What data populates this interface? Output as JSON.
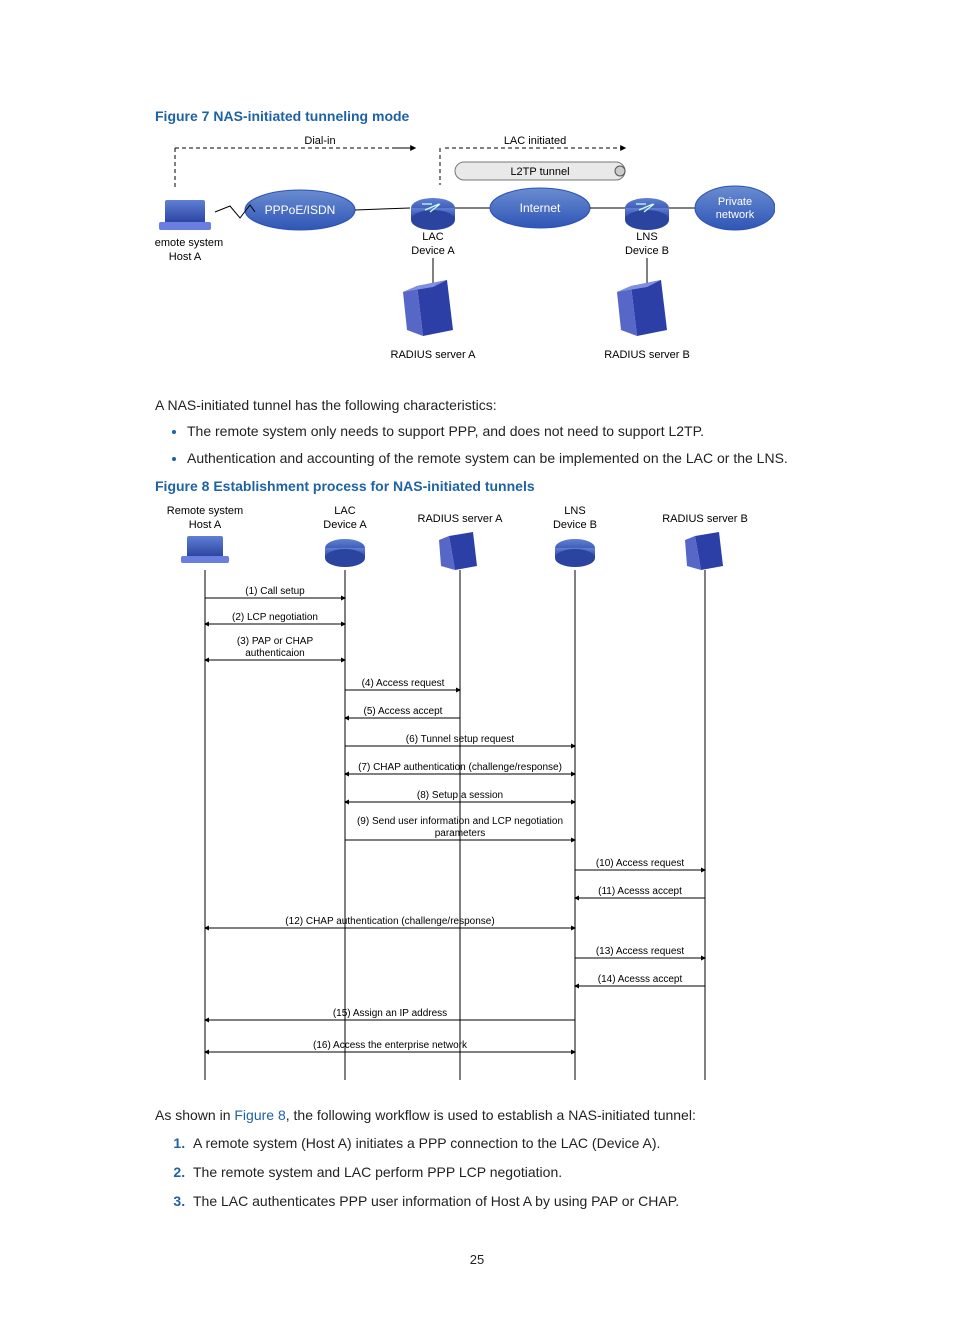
{
  "figure7": {
    "caption": "Figure 7 NAS-initiated tunneling mode",
    "dial_in": "Dial-in",
    "lac_initiated": "LAC initiated",
    "l2tp_tunnel": "L2TP tunnel",
    "pppoe": "PPPoE/ISDN",
    "internet": "Internet",
    "private_net": "Private network",
    "lac": "LAC",
    "dev_a": "Device A",
    "lns": "LNS",
    "dev_b": "Device B",
    "remote_sys": "Remote system",
    "host_a": "Host A",
    "radius_a": "RADIUS server A",
    "radius_b": "RADIUS server B"
  },
  "intro1": "A NAS-initiated tunnel has the following characteristics:",
  "bullets": [
    "The remote system only needs to support PPP, and does not need to support L2TP.",
    "Authentication and accounting of the remote system can be implemented on the LAC or the LNS."
  ],
  "figure8": {
    "caption": "Figure 8 Establishment process for NAS-initiated tunnels",
    "nodes": {
      "remote_sys": "Remote system",
      "host_a": "Host A",
      "lac": "LAC",
      "dev_a": "Device A",
      "radius_a": "RADIUS server A",
      "lns": "LNS",
      "dev_b": "Device B",
      "radius_b": "RADIUS server B"
    },
    "steps": {
      "s1": "(1) Call setup",
      "s2": "(2) LCP negotiation",
      "s3": "(3) PAP or CHAP",
      "s3b": "authenticaion",
      "s4": "(4) Access request",
      "s5": "(5) Access accept",
      "s6": "(6) Tunnel setup request",
      "s7": "(7) CHAP authentication (challenge/response)",
      "s8": "(8) Setup a session",
      "s9a": "(9) Send user information and LCP negotiation",
      "s9b": "parameters",
      "s10": "(10) Access request",
      "s11": "(11) Acesss accept",
      "s12": "(12) CHAP authentication (challenge/response)",
      "s13": "(13) Access request",
      "s14": "(14) Acesss accept",
      "s15": "(15) Assign an IP address",
      "s16": "(16) Access the enterprise network"
    }
  },
  "intro2_pre": "As shown in ",
  "intro2_link": "Figure 8",
  "intro2_post": ", the following workflow is used to establish a NAS-initiated tunnel:",
  "olist": [
    "A remote system (Host A) initiates a PPP connection to the LAC (Device A).",
    "The remote system and LAC perform PPP LCP negotiation.",
    "The LAC authenticates PPP user information of Host A by using PAP or CHAP."
  ],
  "page_number": "25"
}
